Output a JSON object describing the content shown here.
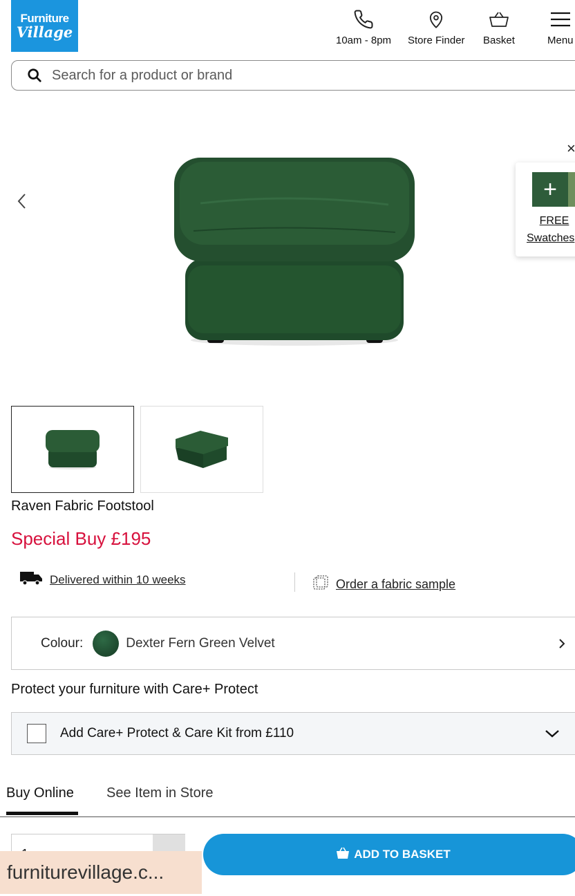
{
  "header": {
    "logo_line1": "Furniture",
    "logo_line2": "Village",
    "nav": [
      {
        "label": "10am - 8pm",
        "icon": "phone-icon"
      },
      {
        "label": "Store Finder",
        "icon": "location-pin-icon"
      },
      {
        "label": "Basket",
        "icon": "basket-icon"
      },
      {
        "label": "Menu",
        "icon": "hamburger-menu-icon"
      }
    ]
  },
  "search": {
    "placeholder": "Search for a product or brand"
  },
  "hero": {
    "swatch_free": "FREE",
    "swatch_label": "Swatches"
  },
  "product": {
    "title": "Raven Fabric Footstool",
    "price": "Special Buy £195",
    "delivery": "Delivered within 10 weeks",
    "sample": "Order a fabric sample",
    "colour_label": "Colour:",
    "colour_value": "Dexter Fern Green Velvet",
    "protect_title": "Protect your furniture with Care+ Protect",
    "care_option": "Add Care+ Protect & Care Kit from £110"
  },
  "tabs": [
    {
      "label": "Buy Online"
    },
    {
      "label": "See Item in Store"
    }
  ],
  "purchase": {
    "quantity": "1",
    "add_button": "ADD TO BASKET"
  },
  "browser": {
    "url_chip": "furniturevillage.c..."
  },
  "colors": {
    "brand_blue": "#1b95de",
    "price_red": "#d7113d",
    "button_blue": "#1795d8",
    "fabric_green": "#1f4d2d"
  }
}
